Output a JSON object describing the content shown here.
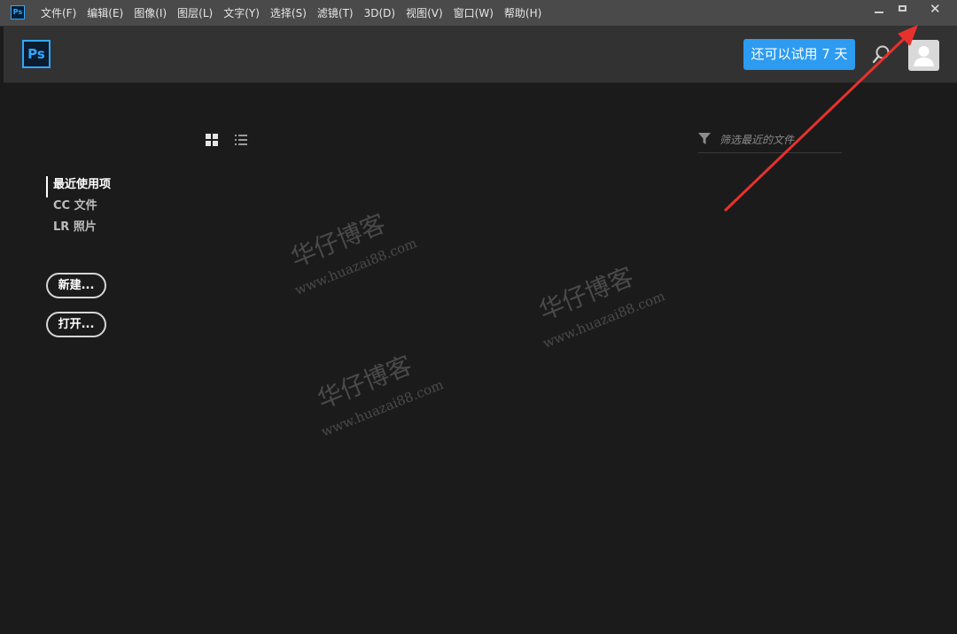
{
  "window": {
    "app_icon_text": "Ps",
    "menu": [
      {
        "label": "文件(F)"
      },
      {
        "label": "编辑(E)"
      },
      {
        "label": "图像(I)"
      },
      {
        "label": "图层(L)"
      },
      {
        "label": "文字(Y)"
      },
      {
        "label": "选择(S)"
      },
      {
        "label": "滤镜(T)"
      },
      {
        "label": "3D(D)"
      },
      {
        "label": "视图(V)"
      },
      {
        "label": "窗口(W)"
      },
      {
        "label": "帮助(H)"
      }
    ],
    "controls": {
      "close_glyph": "✕"
    }
  },
  "header": {
    "logo_text": "Ps",
    "trial_label": "还可以试用 7 天",
    "icons": {
      "search": "search-icon",
      "avatar": "user-avatar-icon"
    }
  },
  "content": {
    "filter_placeholder": "筛选最近的文件",
    "view_toggles": [
      "grid-view-icon",
      "list-view-icon"
    ]
  },
  "sidebar": {
    "items": [
      {
        "label": "最近使用项",
        "active": true
      },
      {
        "label": "CC 文件",
        "active": false
      },
      {
        "label": "LR 照片",
        "active": false
      }
    ],
    "new_label": "新建...",
    "open_label": "打开..."
  },
  "watermark": {
    "title": "华仔博客",
    "url": "www.huazai88.com"
  },
  "colors": {
    "accent": "#2d9bf0",
    "ps_blue": "#31a8ff",
    "background": "#1b1b1b",
    "header": "#323232",
    "titlebar": "#4a4a4a",
    "annotation_arrow": "#e8312d"
  }
}
